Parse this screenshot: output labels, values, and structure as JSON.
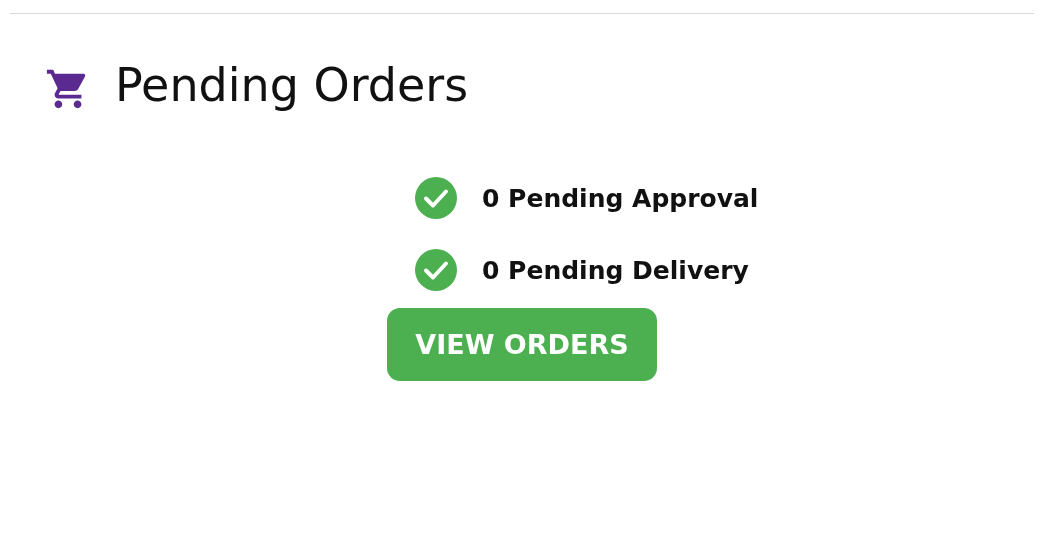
{
  "title": "Pending Orders",
  "statuses": [
    {
      "label": "0 Pending Approval"
    },
    {
      "label": "0 Pending Delivery"
    }
  ],
  "button": "VIEW ORDERS"
}
